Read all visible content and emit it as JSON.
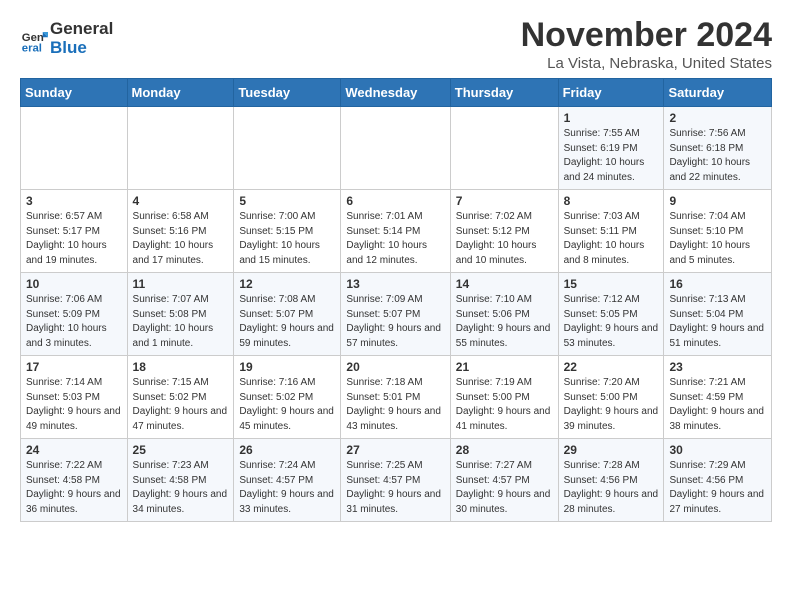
{
  "header": {
    "logo_line1": "General",
    "logo_line2": "Blue",
    "month": "November 2024",
    "location": "La Vista, Nebraska, United States"
  },
  "weekdays": [
    "Sunday",
    "Monday",
    "Tuesday",
    "Wednesday",
    "Thursday",
    "Friday",
    "Saturday"
  ],
  "weeks": [
    [
      {
        "day": "",
        "info": ""
      },
      {
        "day": "",
        "info": ""
      },
      {
        "day": "",
        "info": ""
      },
      {
        "day": "",
        "info": ""
      },
      {
        "day": "",
        "info": ""
      },
      {
        "day": "1",
        "info": "Sunrise: 7:55 AM\nSunset: 6:19 PM\nDaylight: 10 hours and 24 minutes."
      },
      {
        "day": "2",
        "info": "Sunrise: 7:56 AM\nSunset: 6:18 PM\nDaylight: 10 hours and 22 minutes."
      }
    ],
    [
      {
        "day": "3",
        "info": "Sunrise: 6:57 AM\nSunset: 5:17 PM\nDaylight: 10 hours and 19 minutes."
      },
      {
        "day": "4",
        "info": "Sunrise: 6:58 AM\nSunset: 5:16 PM\nDaylight: 10 hours and 17 minutes."
      },
      {
        "day": "5",
        "info": "Sunrise: 7:00 AM\nSunset: 5:15 PM\nDaylight: 10 hours and 15 minutes."
      },
      {
        "day": "6",
        "info": "Sunrise: 7:01 AM\nSunset: 5:14 PM\nDaylight: 10 hours and 12 minutes."
      },
      {
        "day": "7",
        "info": "Sunrise: 7:02 AM\nSunset: 5:12 PM\nDaylight: 10 hours and 10 minutes."
      },
      {
        "day": "8",
        "info": "Sunrise: 7:03 AM\nSunset: 5:11 PM\nDaylight: 10 hours and 8 minutes."
      },
      {
        "day": "9",
        "info": "Sunrise: 7:04 AM\nSunset: 5:10 PM\nDaylight: 10 hours and 5 minutes."
      }
    ],
    [
      {
        "day": "10",
        "info": "Sunrise: 7:06 AM\nSunset: 5:09 PM\nDaylight: 10 hours and 3 minutes."
      },
      {
        "day": "11",
        "info": "Sunrise: 7:07 AM\nSunset: 5:08 PM\nDaylight: 10 hours and 1 minute."
      },
      {
        "day": "12",
        "info": "Sunrise: 7:08 AM\nSunset: 5:07 PM\nDaylight: 9 hours and 59 minutes."
      },
      {
        "day": "13",
        "info": "Sunrise: 7:09 AM\nSunset: 5:07 PM\nDaylight: 9 hours and 57 minutes."
      },
      {
        "day": "14",
        "info": "Sunrise: 7:10 AM\nSunset: 5:06 PM\nDaylight: 9 hours and 55 minutes."
      },
      {
        "day": "15",
        "info": "Sunrise: 7:12 AM\nSunset: 5:05 PM\nDaylight: 9 hours and 53 minutes."
      },
      {
        "day": "16",
        "info": "Sunrise: 7:13 AM\nSunset: 5:04 PM\nDaylight: 9 hours and 51 minutes."
      }
    ],
    [
      {
        "day": "17",
        "info": "Sunrise: 7:14 AM\nSunset: 5:03 PM\nDaylight: 9 hours and 49 minutes."
      },
      {
        "day": "18",
        "info": "Sunrise: 7:15 AM\nSunset: 5:02 PM\nDaylight: 9 hours and 47 minutes."
      },
      {
        "day": "19",
        "info": "Sunrise: 7:16 AM\nSunset: 5:02 PM\nDaylight: 9 hours and 45 minutes."
      },
      {
        "day": "20",
        "info": "Sunrise: 7:18 AM\nSunset: 5:01 PM\nDaylight: 9 hours and 43 minutes."
      },
      {
        "day": "21",
        "info": "Sunrise: 7:19 AM\nSunset: 5:00 PM\nDaylight: 9 hours and 41 minutes."
      },
      {
        "day": "22",
        "info": "Sunrise: 7:20 AM\nSunset: 5:00 PM\nDaylight: 9 hours and 39 minutes."
      },
      {
        "day": "23",
        "info": "Sunrise: 7:21 AM\nSunset: 4:59 PM\nDaylight: 9 hours and 38 minutes."
      }
    ],
    [
      {
        "day": "24",
        "info": "Sunrise: 7:22 AM\nSunset: 4:58 PM\nDaylight: 9 hours and 36 minutes."
      },
      {
        "day": "25",
        "info": "Sunrise: 7:23 AM\nSunset: 4:58 PM\nDaylight: 9 hours and 34 minutes."
      },
      {
        "day": "26",
        "info": "Sunrise: 7:24 AM\nSunset: 4:57 PM\nDaylight: 9 hours and 33 minutes."
      },
      {
        "day": "27",
        "info": "Sunrise: 7:25 AM\nSunset: 4:57 PM\nDaylight: 9 hours and 31 minutes."
      },
      {
        "day": "28",
        "info": "Sunrise: 7:27 AM\nSunset: 4:57 PM\nDaylight: 9 hours and 30 minutes."
      },
      {
        "day": "29",
        "info": "Sunrise: 7:28 AM\nSunset: 4:56 PM\nDaylight: 9 hours and 28 minutes."
      },
      {
        "day": "30",
        "info": "Sunrise: 7:29 AM\nSunset: 4:56 PM\nDaylight: 9 hours and 27 minutes."
      }
    ]
  ]
}
